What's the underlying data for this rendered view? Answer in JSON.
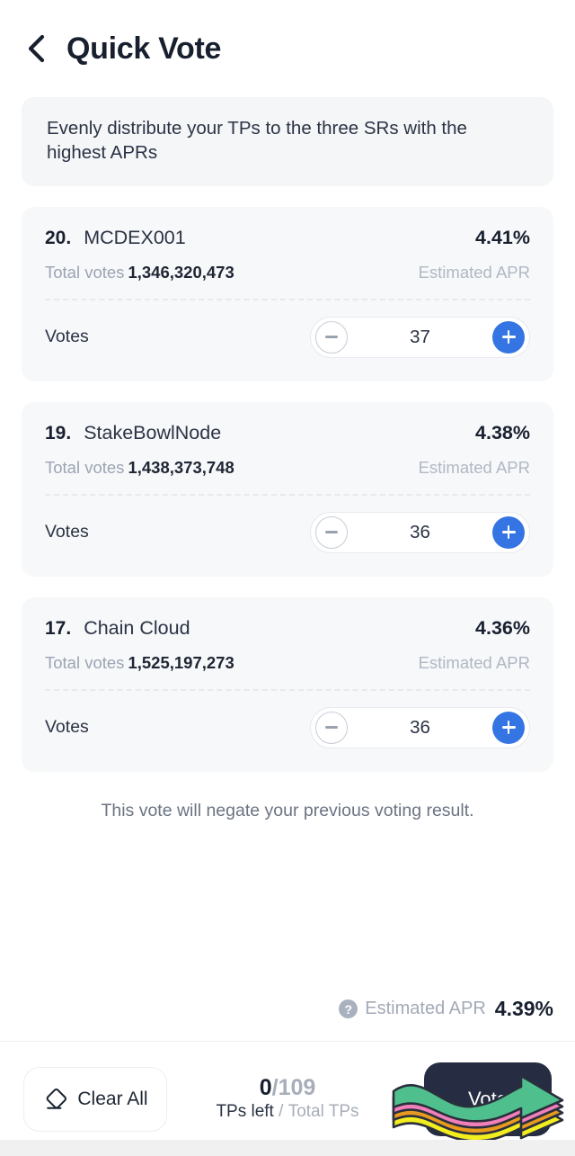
{
  "header": {
    "back_icon": "chevron-left-icon",
    "title": "Quick Vote"
  },
  "banner": {
    "text": "Evenly distribute your TPs to the three SRs with the highest APRs"
  },
  "cards": [
    {
      "rank": "20.",
      "name": "MCDEX001",
      "apr": "4.41%",
      "total_votes_label": "Total votes",
      "total_votes_value": "1,346,320,473",
      "apr_caption": "Estimated APR",
      "votes_label": "Votes",
      "votes_value": "37",
      "minus_icon": "minus-circle-icon",
      "plus_icon": "plus-circle-icon"
    },
    {
      "rank": "19.",
      "name": "StakeBowlNode",
      "apr": "4.38%",
      "total_votes_label": "Total votes",
      "total_votes_value": "1,438,373,748",
      "apr_caption": "Estimated APR",
      "votes_label": "Votes",
      "votes_value": "36",
      "minus_icon": "minus-circle-icon",
      "plus_icon": "plus-circle-icon"
    },
    {
      "rank": "17.",
      "name": "Chain Cloud",
      "apr": "4.36%",
      "total_votes_label": "Total votes",
      "total_votes_value": "1,525,197,273",
      "apr_caption": "Estimated APR",
      "votes_label": "Votes",
      "votes_value": "36",
      "minus_icon": "minus-circle-icon",
      "plus_icon": "plus-circle-icon"
    }
  ],
  "notice": {
    "text": "This vote will negate your previous voting result."
  },
  "summary": {
    "help_icon": "question-mark-icon",
    "help_glyph": "?",
    "label": "Estimated APR",
    "value": "4.39%"
  },
  "footer": {
    "clear_icon": "eraser-icon",
    "clear_label": "Clear All",
    "tps_left": "0",
    "tps_separator": "/",
    "tps_total": "109",
    "caption_left": "TPs left",
    "caption_separator": "/",
    "caption_right": "Total TPs",
    "vote_label": "Vote"
  },
  "annotation": {
    "arrow_icon": "wavy-arrow-right-icon",
    "colors": {
      "green": "#4fc08d",
      "pink": "#f07fba",
      "orange": "#e8991f",
      "yellow": "#f2ed1f",
      "outline": "#2a2f3d"
    }
  },
  "theme": {
    "accent_blue": "#3575e3",
    "dark_navy": "#262d42",
    "card_bg": "#f7f8fa",
    "banner_bg": "#f4f6f8",
    "muted_text": "#a7aeba"
  }
}
